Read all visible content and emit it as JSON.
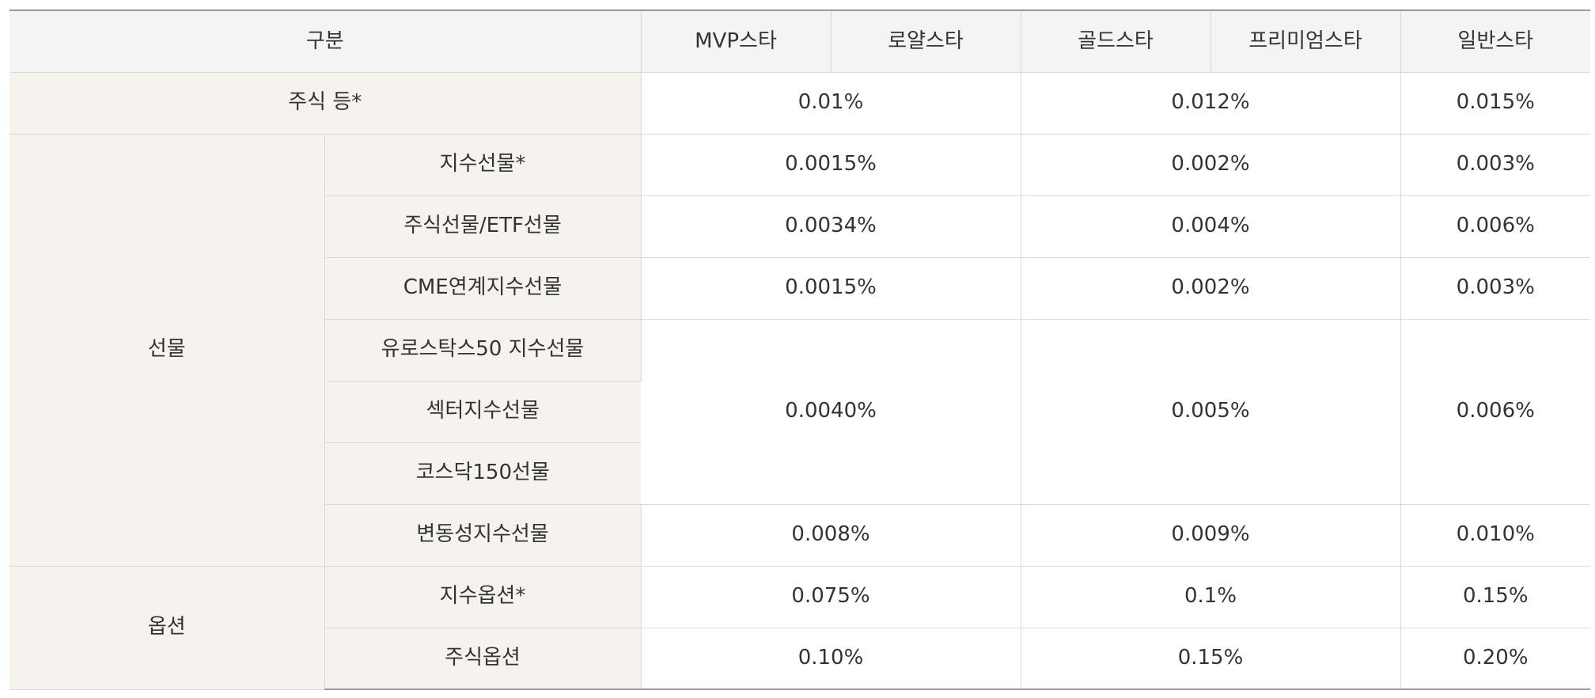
{
  "table": {
    "headers": {
      "category": "구분",
      "mvp": "MVP스타",
      "royal": "로얄스타",
      "gold": "골드스타",
      "premium": "프리미엄스타",
      "normal": "일반스타"
    },
    "rows": {
      "stock": {
        "label": "주식 등*",
        "mvp_royal": "0.01%",
        "gold_premium": "0.012%",
        "normal": "0.015%"
      },
      "futures_group": "선물",
      "index_futures": {
        "label": "지수선물*",
        "mvp_royal": "0.0015%",
        "gold_premium": "0.002%",
        "normal": "0.003%"
      },
      "stock_etf_futures": {
        "label": "주식선물/ETF선물",
        "mvp_royal": "0.0034%",
        "gold_premium": "0.004%",
        "normal": "0.006%"
      },
      "cme_futures": {
        "label": "CME연계지수선물",
        "mvp_royal": "0.0015%",
        "gold_premium": "0.002%",
        "normal": "0.003%"
      },
      "euro_futures": {
        "label": "유로스탁스50 지수선물"
      },
      "sector_futures": {
        "label": "섹터지수선물"
      },
      "kosdaq_futures": {
        "label": "코스닥150선물"
      },
      "merged_futures": {
        "mvp_royal": "0.0040%",
        "gold_premium": "0.005%",
        "normal": "0.006%"
      },
      "vol_futures": {
        "label": "변동성지수선물",
        "mvp_royal": "0.008%",
        "gold_premium": "0.009%",
        "normal": "0.010%"
      },
      "options_group": "옵션",
      "index_options": {
        "label": "지수옵션*",
        "mvp_royal": "0.075%",
        "gold_premium": "0.1%",
        "normal": "0.15%"
      },
      "stock_options": {
        "label": "주식옵션",
        "mvp_royal": "0.10%",
        "gold_premium": "0.15%",
        "normal": "0.20%"
      }
    }
  },
  "colors": {
    "header_bg": "#f4f4f4",
    "label_bg": "#f6f2ee",
    "border": "#d9d9d9",
    "outer_border": "#9a9a9a",
    "text": "#333333"
  }
}
